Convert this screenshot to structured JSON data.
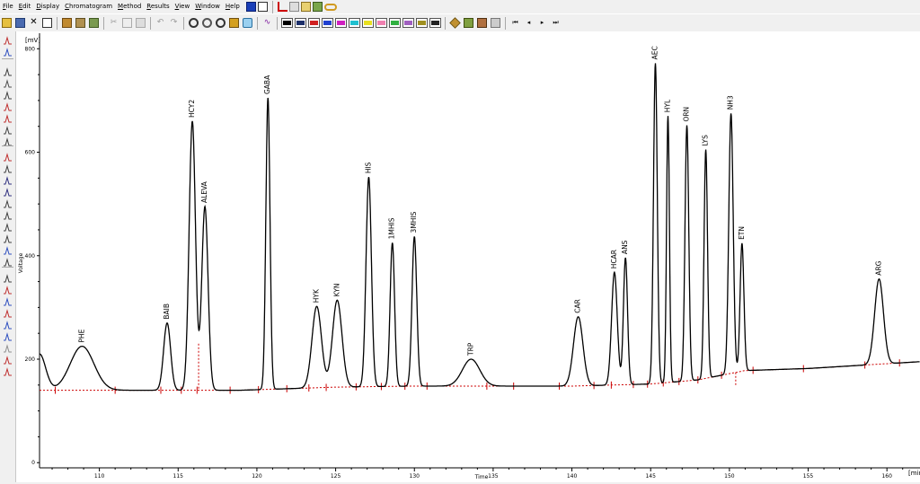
{
  "menu": [
    "File",
    "Edit",
    "Display",
    "Chromatogram",
    "Method",
    "Results",
    "View",
    "Window",
    "Help"
  ],
  "chart_data": {
    "type": "line",
    "title": "",
    "xlabel": "Time",
    "ylabel": "Voltage",
    "x_unit": "[min]",
    "y_unit": "[mV]",
    "xlim": [
      106.2,
      162.1
    ],
    "ylim": [
      -10,
      830
    ],
    "x_ticks": [
      110,
      115,
      120,
      125,
      130,
      135,
      140,
      145,
      150,
      155,
      160
    ],
    "y_ticks": [
      0,
      200,
      400,
      600,
      800
    ],
    "line_color": "#000000",
    "baseline_color": "#cc0000",
    "baseline": [
      [
        106.2,
        140
      ],
      [
        112,
        140
      ],
      [
        119,
        140
      ],
      [
        125,
        146
      ],
      [
        130,
        148
      ],
      [
        135,
        148
      ],
      [
        140,
        148
      ],
      [
        145,
        152
      ],
      [
        148,
        160
      ],
      [
        151,
        178
      ],
      [
        155,
        182
      ],
      [
        162,
        195
      ]
    ],
    "peaks": [
      {
        "name": "PHE",
        "rt": 108.9,
        "height": 225,
        "width": 0.75
      },
      {
        "name": "BAIB",
        "rt": 114.3,
        "height": 270,
        "width": 0.22
      },
      {
        "name": "HCY2",
        "rt": 115.9,
        "height": 660,
        "width": 0.2
      },
      {
        "name": "ALEVA",
        "rt": 116.7,
        "height": 495,
        "width": 0.2
      },
      {
        "name": "GABA",
        "rt": 120.7,
        "height": 705,
        "width": 0.13
      },
      {
        "name": "HYK",
        "rt": 123.8,
        "height": 302,
        "width": 0.3
      },
      {
        "name": "KYN",
        "rt": 125.1,
        "height": 314,
        "width": 0.3
      },
      {
        "name": "HIS",
        "rt": 127.1,
        "height": 552,
        "width": 0.17
      },
      {
        "name": "1MHIS",
        "rt": 128.6,
        "height": 425,
        "width": 0.14
      },
      {
        "name": "3MHIS",
        "rt": 130.0,
        "height": 437,
        "width": 0.15
      },
      {
        "name": "TRP",
        "rt": 133.6,
        "height": 200,
        "width": 0.55
      },
      {
        "name": "CAR",
        "rt": 140.4,
        "height": 282,
        "width": 0.3
      },
      {
        "name": "HCAR",
        "rt": 142.7,
        "height": 368,
        "width": 0.18
      },
      {
        "name": "ANS",
        "rt": 143.4,
        "height": 396,
        "width": 0.13
      },
      {
        "name": "AEC",
        "rt": 145.3,
        "height": 772,
        "width": 0.12
      },
      {
        "name": "HYL",
        "rt": 146.1,
        "height": 670,
        "width": 0.09
      },
      {
        "name": "ORN",
        "rt": 147.3,
        "height": 652,
        "width": 0.12
      },
      {
        "name": "LYS",
        "rt": 148.5,
        "height": 605,
        "width": 0.11
      },
      {
        "name": "NH3",
        "rt": 150.1,
        "height": 675,
        "width": 0.14
      },
      {
        "name": "ETN",
        "rt": 150.8,
        "height": 424,
        "width": 0.12
      },
      {
        "name": "ARG",
        "rt": 159.5,
        "height": 355,
        "width": 0.28
      }
    ],
    "labels_shown": [
      "PHE",
      "BAIB",
      "HCY2",
      "ALEVA",
      "GABA",
      "HYK",
      "KYN",
      "HIS",
      "1MHIS",
      "3MHIS",
      "TRP",
      "CAR",
      "HCAR",
      "ANS",
      "AEC",
      "HYL",
      "ORN",
      "LYS",
      "NH3",
      "ETN",
      "ARG"
    ],
    "boundary_tick_times": [
      107.2,
      111,
      113.9,
      115.2,
      116.2,
      118.3,
      120.1,
      121.9,
      123.3,
      124.4,
      126.3,
      127.9,
      129.4,
      130.8,
      134.6,
      136.3,
      139.2,
      141.4,
      142.5,
      143.9,
      144.8,
      145.8,
      146.8,
      148.0,
      149.5,
      151.5,
      154.7,
      158.6,
      160.8
    ]
  }
}
